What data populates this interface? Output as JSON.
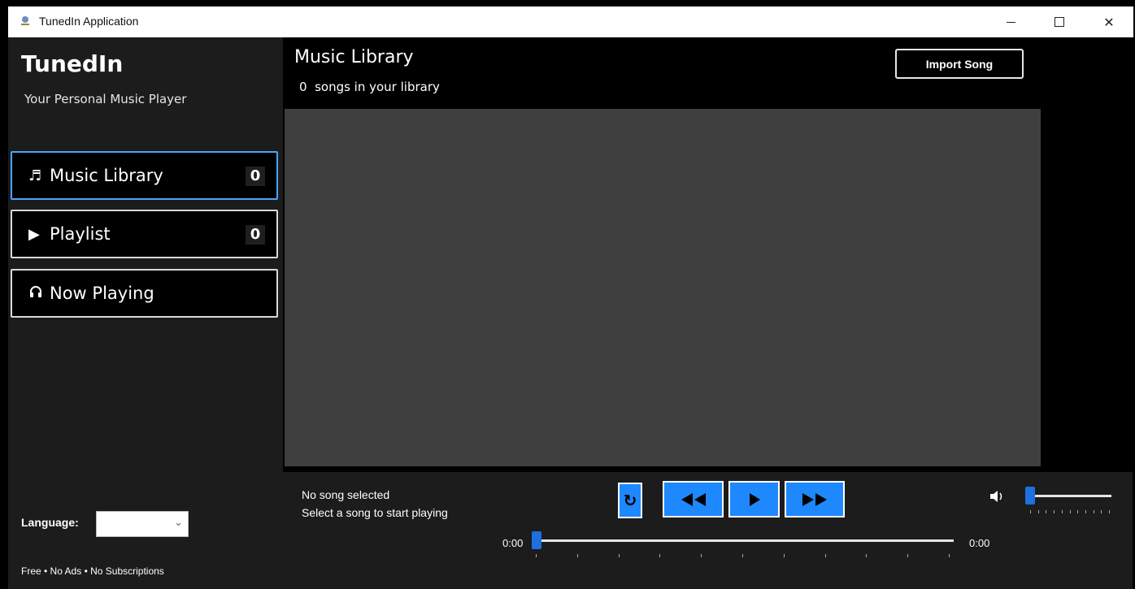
{
  "window": {
    "title": "TunedIn Application",
    "controls": {
      "minimize": "—",
      "maximize": "",
      "close": "✕"
    }
  },
  "sidebar": {
    "brand": "TunedIn",
    "tagline": "Your Personal Music Player",
    "nav": [
      {
        "icon": "♬",
        "icon_name": "music-note-icon",
        "label": "Music Library",
        "count": "0",
        "active": true
      },
      {
        "icon": "▶",
        "icon_name": "play-icon",
        "label": "Playlist",
        "count": "0",
        "active": false
      },
      {
        "icon": "🎧",
        "icon_name": "headphones-icon",
        "label": "Now Playing",
        "count": null,
        "active": false
      }
    ],
    "language_label": "Language:",
    "language_value": "",
    "footer": "Free • No Ads • No Subscriptions"
  },
  "main": {
    "title": "Music Library",
    "song_count_text": "0  songs in your library",
    "import_button": "Import Song",
    "songs": []
  },
  "player": {
    "now_playing_title": "No song selected",
    "now_playing_subtitle": "Select a song to start playing",
    "loop_icon": "↻",
    "prev_icon": "◀◀",
    "play_icon": "▶",
    "next_icon": "▶▶",
    "time_current": "0:00",
    "time_total": "0:00",
    "progress": 0,
    "volume_icon": "🔊",
    "volume": 0
  },
  "colors": {
    "accent": "#1e88ff",
    "active_border": "#4da3ff",
    "sidebar_bg": "#1c1c1c",
    "list_bg": "#3f3f3f"
  }
}
